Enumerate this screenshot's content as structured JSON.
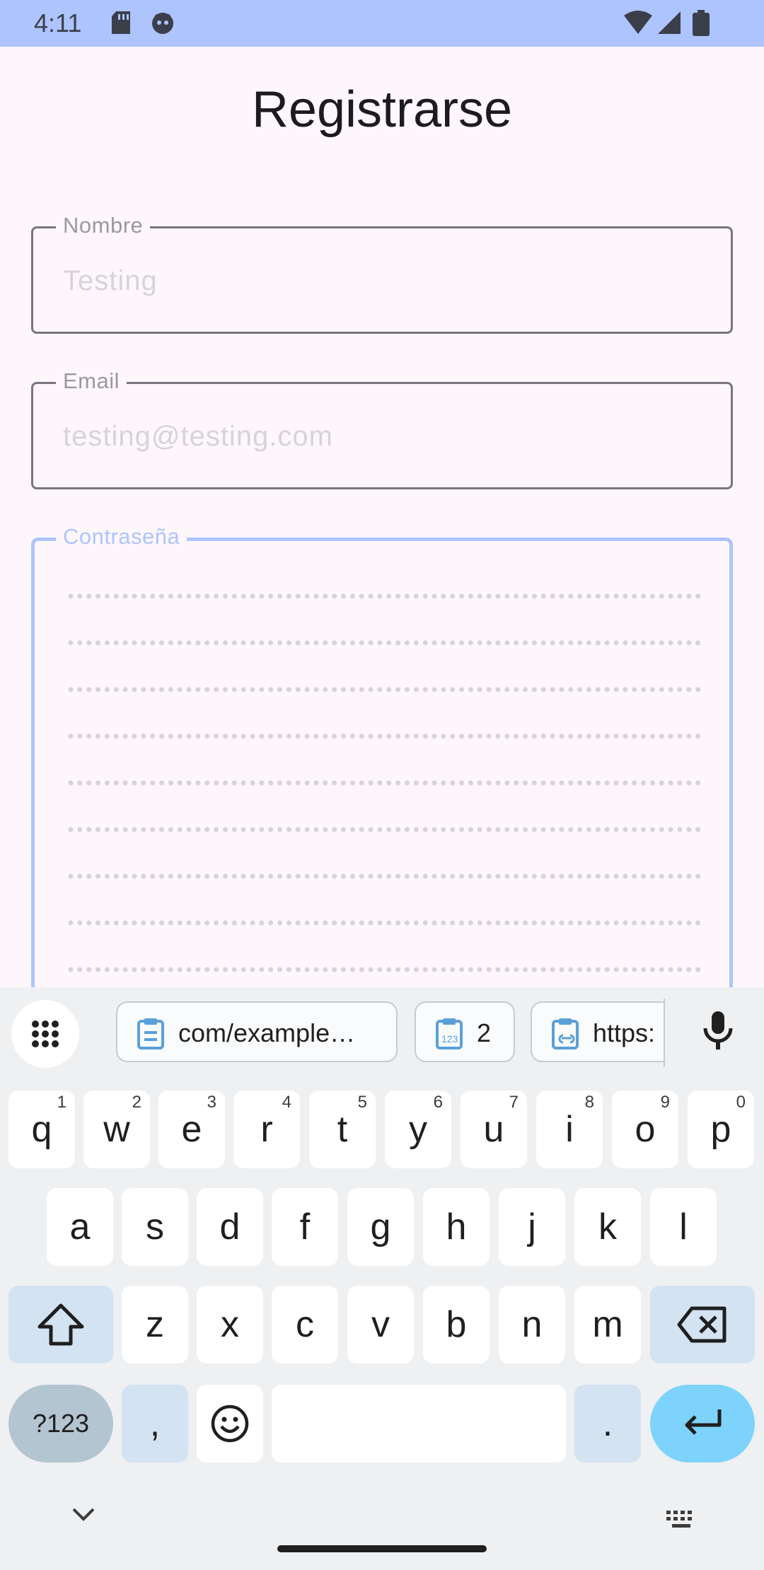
{
  "status_bar": {
    "time": "4:11"
  },
  "form": {
    "title": "Registrarse",
    "fields": [
      {
        "label": "Nombre",
        "value": "Testing"
      },
      {
        "label": "Email",
        "value": "testing@testing.com"
      },
      {
        "label": "Contraseña",
        "value": ""
      }
    ]
  },
  "keyboard": {
    "clipboard_chips": [
      {
        "text": "com/example…",
        "icon": "clipboard-icon"
      },
      {
        "text": "2",
        "icon": "clipboard-number-icon"
      },
      {
        "text": "https:",
        "icon": "clipboard-link-icon"
      }
    ],
    "rows": {
      "row1": [
        {
          "key": "q",
          "hint": "1"
        },
        {
          "key": "w",
          "hint": "2"
        },
        {
          "key": "e",
          "hint": "3"
        },
        {
          "key": "r",
          "hint": "4"
        },
        {
          "key": "t",
          "hint": "5"
        },
        {
          "key": "y",
          "hint": "6"
        },
        {
          "key": "u",
          "hint": "7"
        },
        {
          "key": "i",
          "hint": "8"
        },
        {
          "key": "o",
          "hint": "9"
        },
        {
          "key": "p",
          "hint": "0"
        }
      ],
      "row2": [
        "a",
        "s",
        "d",
        "f",
        "g",
        "h",
        "j",
        "k",
        "l"
      ],
      "row3": [
        "z",
        "x",
        "c",
        "v",
        "b",
        "n",
        "m"
      ],
      "symbols": "?123",
      "comma": ",",
      "period": "."
    }
  },
  "colors": {
    "accent": "#aec4ff",
    "enter_key": "#7dd3fb",
    "function_key": "#d3e3f2"
  }
}
